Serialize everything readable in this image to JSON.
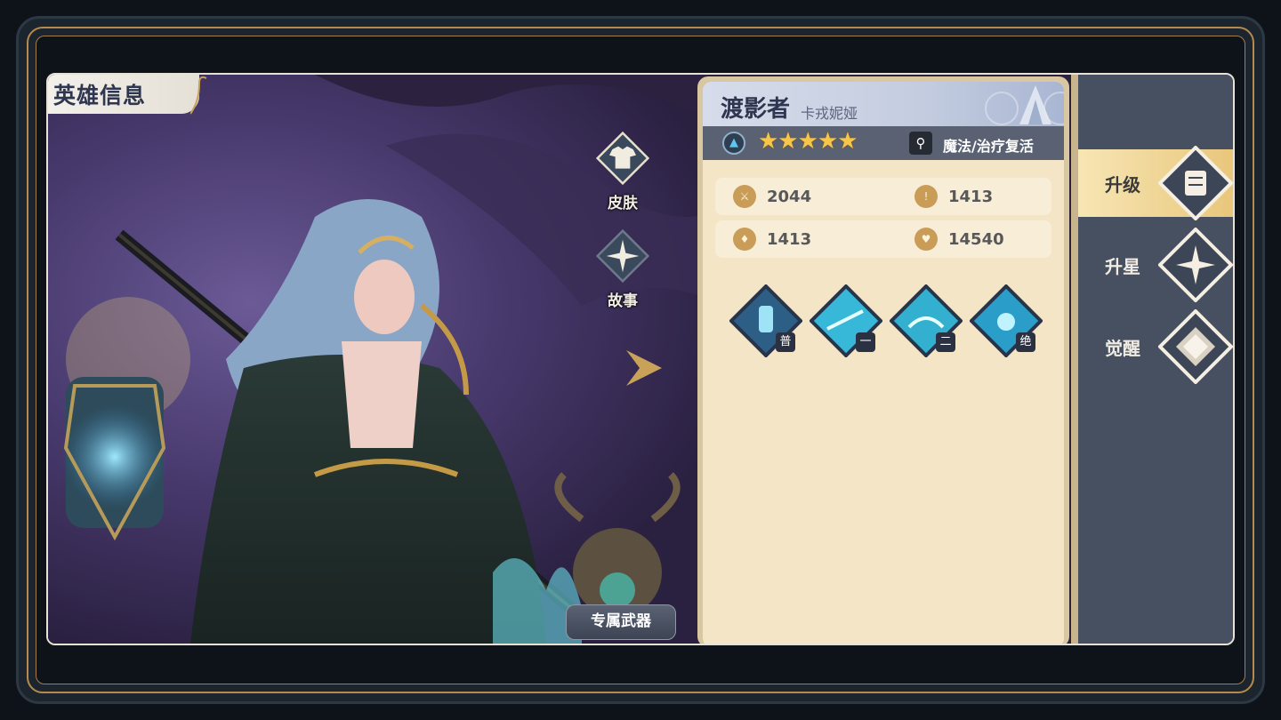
{
  "screen_title": "英雄信息",
  "side_buttons": {
    "skin": "皮肤",
    "story": "故事"
  },
  "weapon_button": "专属武器",
  "hero": {
    "name": "渡影者",
    "subname": "卡戎妮娅",
    "stars": "★★★★★",
    "star_count": 5,
    "class_text": "魔法/治疗复活"
  },
  "stats": {
    "attack": "2044",
    "defense": "1413",
    "magic_defense": "1413",
    "hp": "14540"
  },
  "skills": [
    {
      "tag": "普"
    },
    {
      "tag": "一"
    },
    {
      "tag": "二"
    },
    {
      "tag": "绝"
    }
  ],
  "tabs": {
    "upgrade": "升级",
    "star_up": "升星",
    "awaken": "觉醒"
  },
  "colors": {
    "panel_bg": "#f3e5c6",
    "star": "#f5c64a",
    "tab_col": "#475060",
    "active_tab": "#e8c67a"
  }
}
